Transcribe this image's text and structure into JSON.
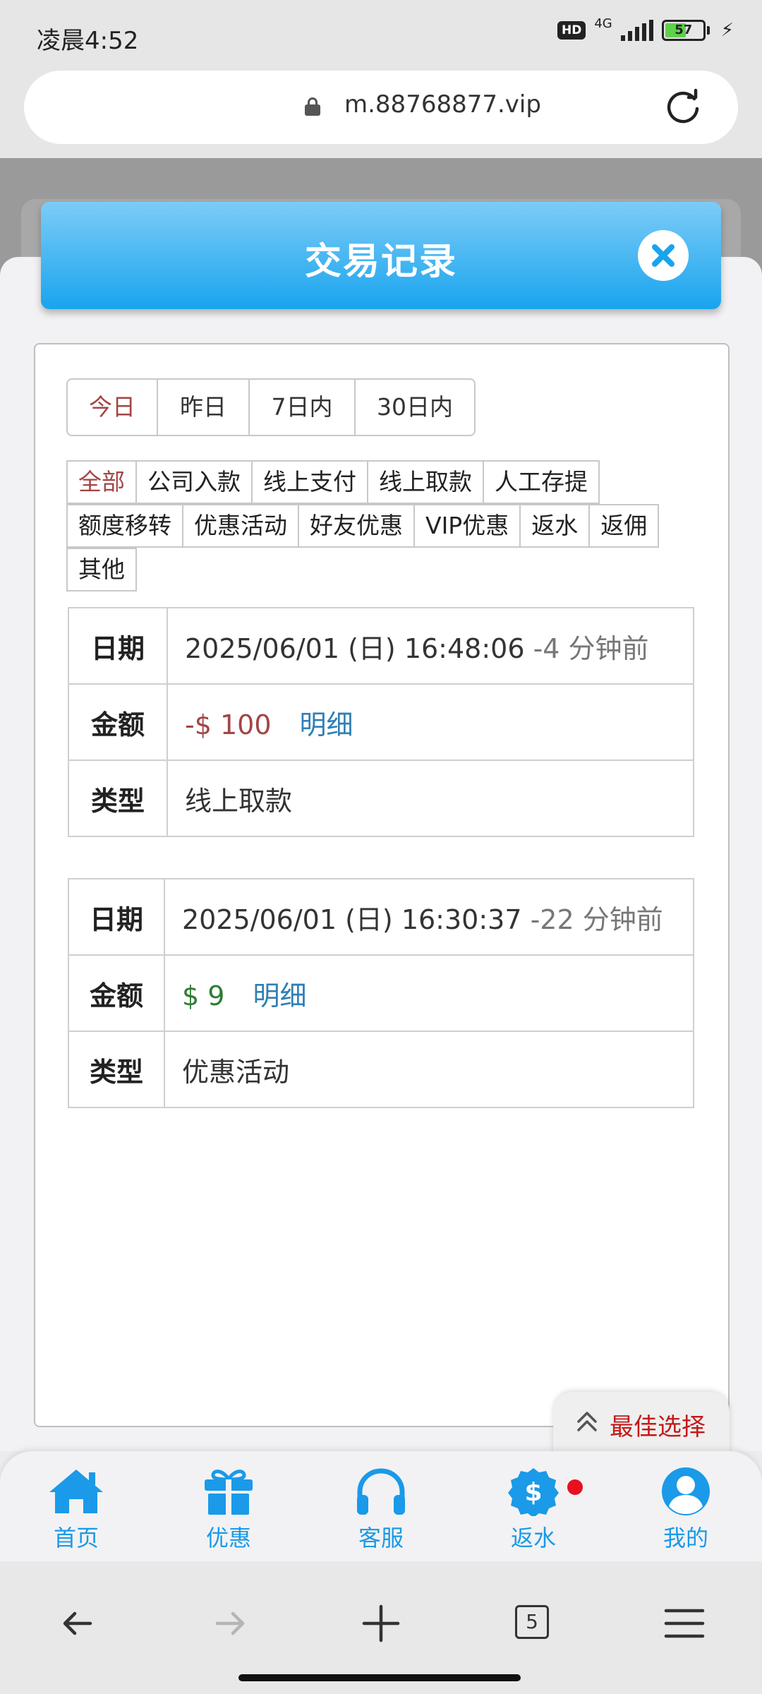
{
  "status_bar": {
    "time": "凌晨4:52",
    "hd_label": "HD",
    "network": "4G",
    "battery": "57",
    "battery_level": 0.57
  },
  "browser": {
    "url": "m.88768877.vip",
    "tab_count": "5"
  },
  "modal": {
    "title": "交易记录"
  },
  "date_filters": [
    {
      "label": "今日",
      "active": true
    },
    {
      "label": "昨日",
      "active": false
    },
    {
      "label": "7日内",
      "active": false
    },
    {
      "label": "30日内",
      "active": false
    }
  ],
  "category_filters": [
    {
      "label": "全部",
      "active": true
    },
    {
      "label": "公司入款",
      "active": false
    },
    {
      "label": "线上支付",
      "active": false
    },
    {
      "label": "线上取款",
      "active": false
    },
    {
      "label": "人工存提",
      "active": false
    },
    {
      "label": "额度移转",
      "active": false
    },
    {
      "label": "优惠活动",
      "active": false
    },
    {
      "label": "好友优惠",
      "active": false
    },
    {
      "label": "VIP优惠",
      "active": false
    },
    {
      "label": "返水",
      "active": false
    },
    {
      "label": "返佣",
      "active": false
    },
    {
      "label": "其他",
      "active": false
    }
  ],
  "record_labels": {
    "date": "日期",
    "amount": "金额",
    "type": "类型",
    "detail": "明细"
  },
  "records": [
    {
      "date": "2025/06/01 (日) 16:48:06",
      "ago": "-4 分钟前",
      "amount": "-$ 100",
      "type": "线上取款"
    },
    {
      "date": "2025/06/01 (日) 16:30:37",
      "ago": "-22 分钟前",
      "amount": "$ 9",
      "type": "优惠活动"
    }
  ],
  "best_choice": "最佳选择",
  "bottom_nav": [
    {
      "label": "首页",
      "icon": "home-icon"
    },
    {
      "label": "优惠",
      "icon": "gift-icon"
    },
    {
      "label": "客服",
      "icon": "headset-icon"
    },
    {
      "label": "返水",
      "icon": "dollar-badge-icon"
    },
    {
      "label": "我的",
      "icon": "user-icon"
    }
  ],
  "colors": {
    "accent": "#1a9ae8",
    "active_filter": "#a34545",
    "negative_amount": "#a34545",
    "positive_amount": "#2e7d32",
    "link": "#2f7fb6",
    "best_choice": "#c21a1a"
  }
}
